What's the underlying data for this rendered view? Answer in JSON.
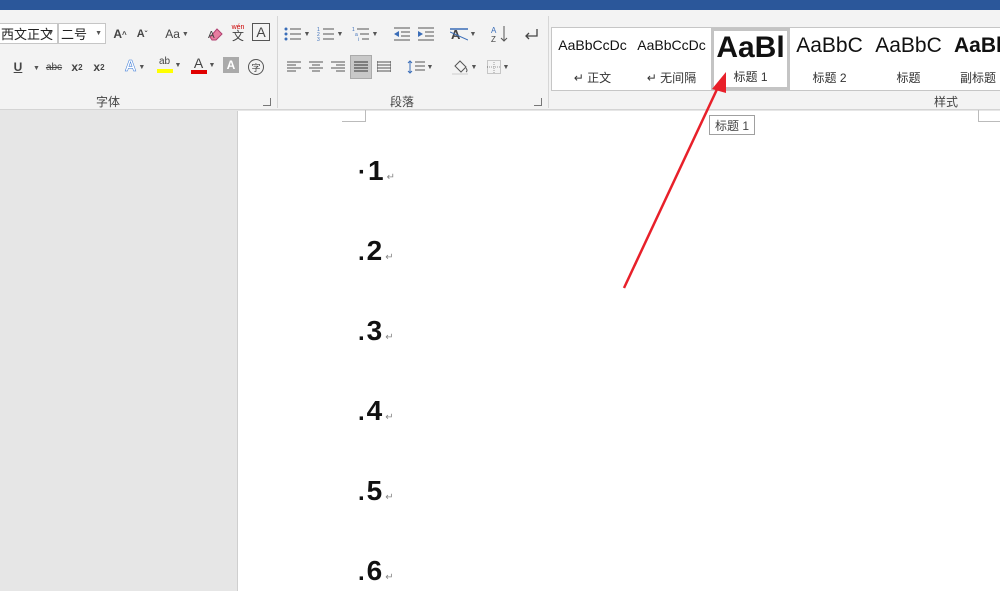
{
  "ribbon": {
    "font_group": {
      "label": "字体",
      "font_name": "西文正文",
      "font_size": "二号",
      "change_case_label": "Aa",
      "phonetic_top": "wén",
      "phonetic_bottom": "文",
      "char_border": "A",
      "underline": "U",
      "strikethrough": "abc",
      "subscript": "x",
      "subscript_mark": "2",
      "superscript": "x",
      "superscript_mark": "2",
      "text_effects": "A",
      "highlight": "ab",
      "font_color": "A",
      "char_shading": "A",
      "enclose_char": "字",
      "grow_font": "A",
      "shrink_font": "A",
      "highlight_color": "#ffff00",
      "font_color_value": "#e00000"
    },
    "paragraph_group": {
      "label": "段落"
    },
    "styles_group": {
      "label": "样式",
      "items": [
        {
          "preview": "AaBbCcDc",
          "name": "↵ 正文"
        },
        {
          "preview": "AaBbCcDc",
          "name": "↵ 无间隔"
        },
        {
          "preview": "AaBl",
          "name": "标题 1"
        },
        {
          "preview": "AaBbC",
          "name": "标题 2"
        },
        {
          "preview": "AaBbC",
          "name": "标题"
        },
        {
          "preview": "AaBl",
          "name": "副标题"
        }
      ]
    }
  },
  "tooltip": "标题 1",
  "document": {
    "paragraph_mark": "↵",
    "headings": [
      {
        "bullet": "·",
        "text": "1"
      },
      {
        "bullet": ".",
        "text": "2"
      },
      {
        "bullet": ".",
        "text": "3"
      },
      {
        "bullet": ".",
        "text": "4"
      },
      {
        "bullet": ".",
        "text": "5"
      },
      {
        "bullet": ".",
        "text": "6"
      }
    ]
  },
  "annotation": {
    "arrow_color": "#e8202a"
  }
}
